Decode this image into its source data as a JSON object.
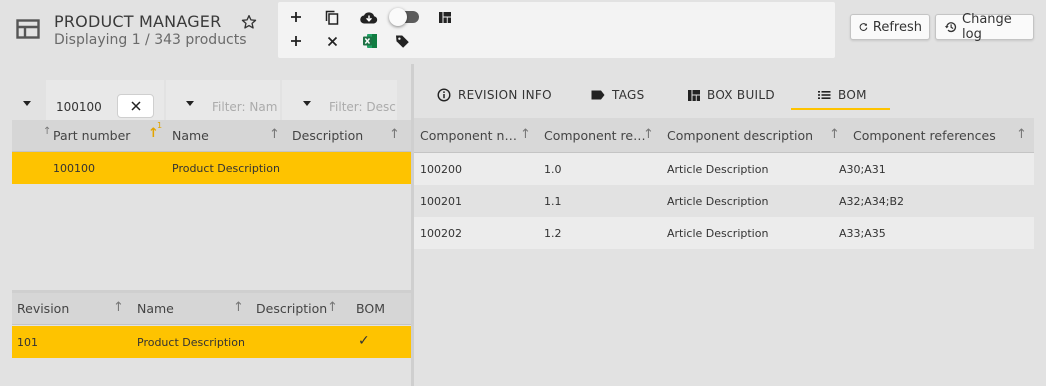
{
  "header": {
    "title": "PRODUCT MANAGER",
    "subtitle": "Displaying 1 / 343 products",
    "app_icon": "table-layout-icon",
    "favorite_icon": "star-outline-icon"
  },
  "toolbar": {
    "row1": [
      "add-icon",
      "copy-icon",
      "cloud-download-icon",
      "toggle",
      "view-quilt-icon"
    ],
    "row2": [
      "add-icon",
      "close-icon",
      "excel-icon",
      "tag-icon"
    ]
  },
  "buttons": {
    "refresh": "Refresh",
    "changelog": "Change log"
  },
  "filters": {
    "part_number_value": "100100",
    "name_placeholder": "Filter: Nam",
    "description_placeholder": "Filter: Desc"
  },
  "products_grid": {
    "columns": [
      "Part number",
      "Name",
      "Description"
    ],
    "sort_badge": "1",
    "rows": [
      {
        "part_number": "100100",
        "name": "Product Description",
        "description": ""
      }
    ]
  },
  "revisions_grid": {
    "columns": [
      "Revision",
      "Name",
      "Description",
      "BOM"
    ],
    "rows": [
      {
        "revision": "101",
        "name": "Product Description",
        "description": "",
        "bom": "✓"
      }
    ]
  },
  "tabs": [
    {
      "label": "REVISION INFO",
      "icon": "info-icon"
    },
    {
      "label": "TAGS",
      "icon": "label-icon"
    },
    {
      "label": "BOX BUILD",
      "icon": "view-quilt-icon"
    },
    {
      "label": "BOM",
      "icon": "list-icon",
      "active": true
    }
  ],
  "bom_grid": {
    "columns": [
      "Component n…",
      "Component re…",
      "Component description",
      "Component references"
    ],
    "rows": [
      {
        "number": "100200",
        "revision": "1.0",
        "description": "Article Description",
        "references": "A30;A31"
      },
      {
        "number": "100201",
        "revision": "1.1",
        "description": "Article Description",
        "references": "A32;A34;B2"
      },
      {
        "number": "100202",
        "revision": "1.2",
        "description": "Article Description",
        "references": "A33;A35"
      }
    ]
  },
  "colors": {
    "accent": "#fec300",
    "background": "#e2e2e2",
    "toolbar": "#f3f3f3",
    "excel_green": "#1e7145"
  }
}
